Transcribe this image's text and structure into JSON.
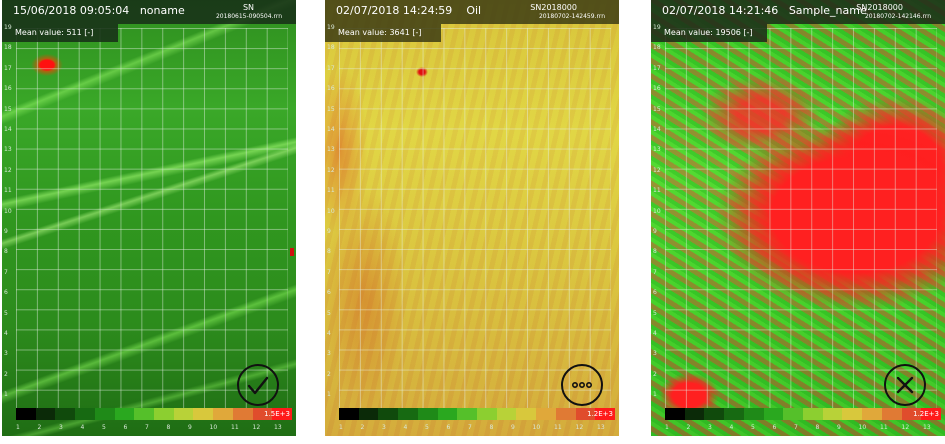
{
  "panels": [
    {
      "datetime": "15/06/2018 09:05:04",
      "sample": "noname",
      "sn_label": "SN",
      "sn_value": "",
      "file": "20180615-090504.rrn",
      "mean_label": "Mean value:",
      "mean_value": "511 [-]",
      "scale_max": "1.5E+3",
      "status": "accepted",
      "status_icon": "check-icon"
    },
    {
      "datetime": "02/07/2018 14:24:59",
      "sample": "Oil",
      "sn_label": "SN2018000",
      "sn_value": "",
      "file": "20180702-142459.rrn",
      "mean_label": "Mean value:",
      "mean_value": "3641 [-]",
      "scale_max": "1.2E+3",
      "status": "pending",
      "status_icon": "ellipsis-icon"
    },
    {
      "datetime": "02/07/2018 14:21:46",
      "sample": "Sample_name",
      "sn_label": "SN2018000",
      "sn_value": "",
      "file": "20180702-142146.rrn",
      "mean_label": "Mean value:",
      "mean_value": "19506 [-]",
      "scale_max": "1.2E+3",
      "status": "rejected",
      "status_icon": "cross-icon"
    }
  ],
  "axes": {
    "y_ticks": [
      "19",
      "18",
      "17",
      "16",
      "15",
      "14",
      "13",
      "12",
      "11",
      "10",
      "9",
      "8",
      "7",
      "6",
      "5",
      "4",
      "3",
      "2",
      "1"
    ],
    "x_ticks": [
      "1",
      "2",
      "3",
      "4",
      "5",
      "6",
      "7",
      "8",
      "9",
      "10",
      "11",
      "12",
      "13"
    ]
  },
  "colorbar": [
    "#000000",
    "#0b2a08",
    "#104a0c",
    "#176a12",
    "#1f8a18",
    "#2aa81f",
    "#55c02a",
    "#8ccf30",
    "#b8d238",
    "#d8c83c",
    "#e0a83a",
    "#e07a34",
    "#e04c2c",
    "#ff1a1a"
  ]
}
